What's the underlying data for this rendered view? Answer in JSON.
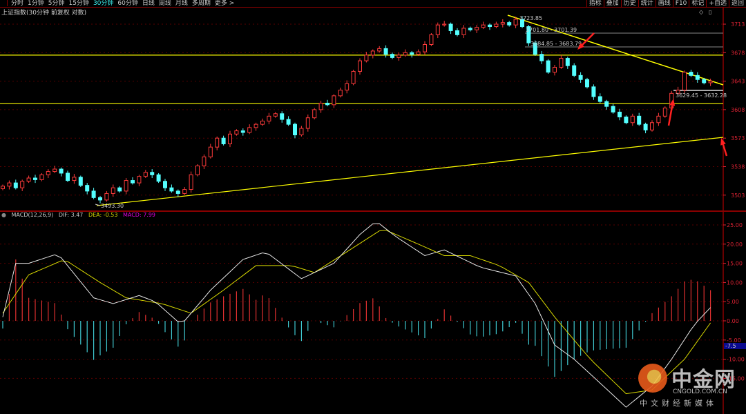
{
  "toolbar": {
    "periods": [
      "分时",
      "1分钟",
      "5分钟",
      "15分钟",
      "30分钟",
      "60分钟",
      "日线",
      "周线",
      "月线",
      "多周期",
      "更多 >"
    ],
    "active_period": "30分钟",
    "actions": [
      "指标",
      "叠加",
      "历史",
      "统计",
      "画线",
      "F10",
      "标记",
      "+自选",
      "返回"
    ]
  },
  "title": "上证指数(30分钟 前复权 对数)",
  "macd_legend": {
    "name": "MACD(12,26,9)",
    "dif": "DIF: 3.47",
    "dea": "DEA: -0.53",
    "macd": "MACD: 7.99"
  },
  "colors": {
    "up": "#ff3b3b",
    "down": "#54ffff",
    "dif": "#e8e8e8",
    "dea": "#d8d800",
    "macd_label": "#e000e0",
    "trendline": "#ffff00"
  },
  "annotations": {
    "high": "3723.85",
    "level1": "3701.80 - 3701.39",
    "level2": "3684.85 - 3683.79",
    "level3": "3629.45 - 3632.28",
    "low": "3493.30"
  },
  "cursor_value": "-7.5",
  "watermark": {
    "cn": "中金网",
    "en": "CNGOLD.COM.CN",
    "sub": "中文财经新媒体"
  },
  "chart_data": [
    {
      "type": "candlestick",
      "title": "上证指数 30分钟",
      "y_ticks": [
        3713,
        3678,
        3643,
        3608,
        3573,
        3538,
        3503
      ],
      "ylim": [
        3490,
        3730
      ],
      "horizontal_lines": [
        3675,
        3615.5
      ],
      "closes": [
        3514,
        3518,
        3512,
        3520,
        3524,
        3522,
        3528,
        3532,
        3535,
        3530,
        3521,
        3525,
        3515,
        3508,
        3500,
        3497,
        3505,
        3512,
        3508,
        3521,
        3518,
        3526,
        3531,
        3528,
        3520,
        3512,
        3508,
        3505,
        3510,
        3528,
        3539,
        3550,
        3562,
        3573,
        3566,
        3578,
        3582,
        3580,
        3586,
        3590,
        3594,
        3600,
        3603,
        3596,
        3590,
        3577,
        3585,
        3598,
        3608,
        3616,
        3614,
        3625,
        3632,
        3640,
        3655,
        3668,
        3675,
        3680,
        3683,
        3676,
        3672,
        3675,
        3678,
        3676,
        3679,
        3688,
        3700,
        3712,
        3713,
        3705,
        3700,
        3708,
        3706,
        3709,
        3712,
        3710,
        3713,
        3715,
        3712,
        3719,
        3710,
        3690,
        3676,
        3668,
        3654,
        3660,
        3671,
        3662,
        3650,
        3645,
        3636,
        3624,
        3618,
        3612,
        3605,
        3599,
        3592,
        3600,
        3590,
        3583,
        3592,
        3600,
        3610,
        3628,
        3632,
        3654,
        3650,
        3645,
        3641,
        3643
      ]
    },
    {
      "type": "line",
      "title": "MACD(12,26,9)",
      "y_ticks": [
        "25.00",
        "20.00",
        "15.00",
        "10.00",
        "5.00",
        "0.00",
        "-5.00",
        "-10.00",
        "-15.00"
      ],
      "ylim": [
        -25,
        28
      ],
      "dif_keypoints": [
        [
          0,
          1
        ],
        [
          2,
          15
        ],
        [
          4,
          15
        ],
        [
          8.5,
          17.5
        ],
        [
          14,
          6
        ],
        [
          17,
          4.5
        ],
        [
          21,
          6.6
        ],
        [
          23.5,
          5
        ],
        [
          27.5,
          -1
        ],
        [
          32,
          8
        ],
        [
          37,
          16
        ],
        [
          40.5,
          18
        ],
        [
          46,
          11
        ],
        [
          51,
          15
        ],
        [
          55,
          22.5
        ],
        [
          57.5,
          26
        ],
        [
          60.5,
          22
        ],
        [
          65,
          17
        ],
        [
          68,
          18.5
        ],
        [
          73.5,
          14
        ],
        [
          79,
          11.7
        ],
        [
          82,
          4.5
        ],
        [
          85,
          -6.3
        ],
        [
          88,
          -10
        ],
        [
          92.5,
          -17
        ],
        [
          96,
          -22.5
        ],
        [
          100,
          -17
        ],
        [
          103,
          -10
        ],
        [
          106.5,
          -1
        ],
        [
          109,
          3.47
        ]
      ],
      "dea_keypoints": [
        [
          0,
          2
        ],
        [
          4,
          12
        ],
        [
          9.5,
          16
        ],
        [
          15,
          10
        ],
        [
          19,
          6
        ],
        [
          24.5,
          4.5
        ],
        [
          29,
          2
        ],
        [
          34,
          8
        ],
        [
          39,
          14.4
        ],
        [
          44.5,
          14.4
        ],
        [
          48,
          12.6
        ],
        [
          53,
          18
        ],
        [
          58.5,
          24
        ],
        [
          64,
          20
        ],
        [
          68,
          17
        ],
        [
          72,
          17
        ],
        [
          76.5,
          14.4
        ],
        [
          81,
          10
        ],
        [
          85,
          1
        ],
        [
          90.5,
          -10
        ],
        [
          96,
          -19
        ],
        [
          100,
          -18
        ],
        [
          105,
          -10
        ],
        [
          109,
          -0.53
        ]
      ]
    }
  ]
}
